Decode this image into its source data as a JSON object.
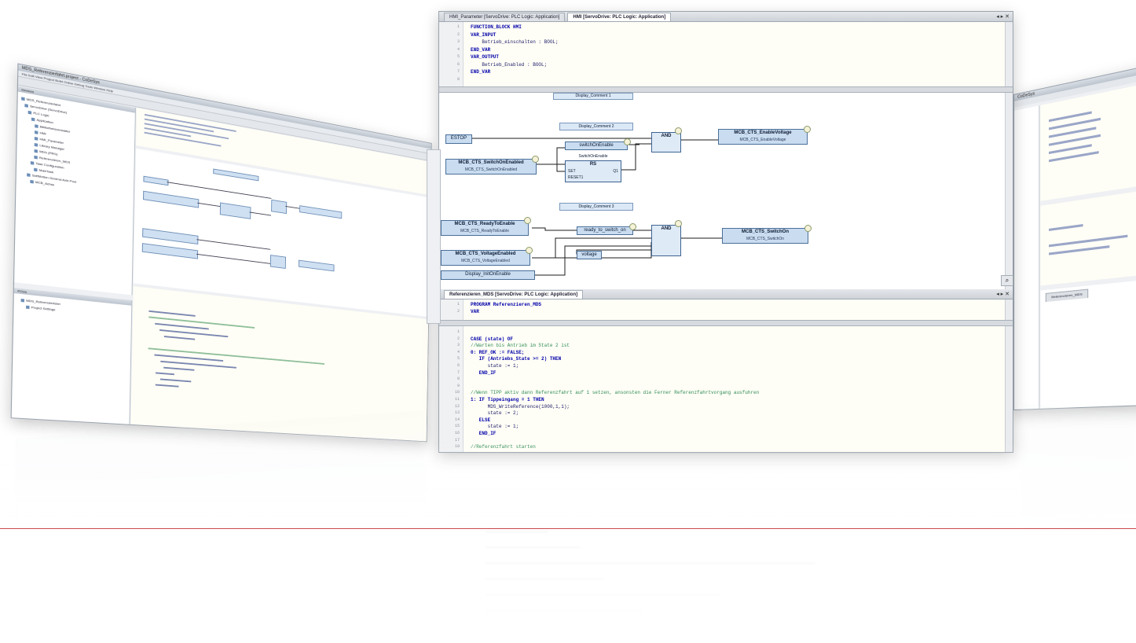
{
  "center_window": {
    "tabs": [
      {
        "label": "HMI_Parameter [ServoDrive: PLC Logic: Application]"
      },
      {
        "label": "HMI [ServoDrive: PLC Logic: Application]"
      }
    ],
    "window_controls": "◂ ▸ ✕",
    "declaration": [
      {
        "ln": "1",
        "text": "FUNCTION_BLOCK HMI",
        "style": "kw"
      },
      {
        "ln": "2",
        "text": "VAR_INPUT",
        "style": "kw"
      },
      {
        "ln": "3",
        "text": "    Betrieb_einschalten : BOOL;",
        "style": ""
      },
      {
        "ln": "4",
        "text": "END_VAR",
        "style": "kw"
      },
      {
        "ln": "5",
        "text": "VAR_OUTPUT",
        "style": "kw"
      },
      {
        "ln": "6",
        "text": "    Betrieb_Enabled : BOOL;",
        "style": ""
      },
      {
        "ln": "7",
        "text": "END_VAR",
        "style": "kw"
      },
      {
        "ln": "8",
        "text": "",
        "style": ""
      }
    ],
    "fbd": {
      "labels": {
        "comment1": "Display_Comment 1",
        "comment2": "Display_Comment 2",
        "comment3": "Display_Comment 3",
        "estop": "ESTOP",
        "mc_switch_title": "MCB_CTS_SwitchOnEnabled",
        "mc_switch_sub": "MCB_CTS_SwitchOnEnabled",
        "switchable": "switchOnEnable",
        "rs_label": "SwitchOnEnable",
        "rs_title": "RS",
        "rs_set": "SET",
        "rs_reset": "RESET1",
        "rs_q": "Q1",
        "and1": "AND",
        "out1_title": "MCB_CTS_EnableVoltage",
        "out1_sub": "MCB_CTS_EnableVoltage",
        "ready_title": "MCB_CTS_ReadyToEnable",
        "ready_sub": "MCB_CTS_ReadyToEnable",
        "ready_var": "ready_to_switch_on",
        "volt_title": "MCB_CTS_VoltageEnabled",
        "volt_sub": "MCB_CTS_VoltageEnabled",
        "voltage": "voltage",
        "and2": "AND",
        "out2_title": "MCB_CTS_SwitchOn",
        "out2_sub": "MCB_CTS_SwitchOn",
        "display_var": "Display_InitOnEnable"
      }
    },
    "bottom_tabs": [
      {
        "label": "Referenzieren_MDS [ServoDrive: PLC Logic: Application]"
      }
    ],
    "bottom_declaration": [
      {
        "ln": "1",
        "text": "PROGRAM Referenzieren_MDS",
        "style": "kw"
      },
      {
        "ln": "2",
        "text": "VAR",
        "style": "kw"
      }
    ],
    "body_code": [
      {
        "ln": "1",
        "text": "",
        "style": ""
      },
      {
        "ln": "2",
        "text": "CASE (state) OF",
        "style": "kw"
      },
      {
        "ln": "3",
        "text": "//Warten bis Antrieb im State 2 ist",
        "style": "cm"
      },
      {
        "ln": "4",
        "text": "0: REF_OK := FALSE;",
        "style": "kw"
      },
      {
        "ln": "5",
        "text": "   IF (Antriebs_State >= 2) THEN",
        "style": "kw"
      },
      {
        "ln": "6",
        "text": "      state := 1;",
        "style": ""
      },
      {
        "ln": "7",
        "text": "   END_IF",
        "style": "kw"
      },
      {
        "ln": "8",
        "text": "",
        "style": ""
      },
      {
        "ln": "9",
        "text": "",
        "style": ""
      },
      {
        "ln": "10",
        "text": "//Wenn TIPP aktiv dann Referenzfahrt auf 1 setzen, ansonsten die Ferner Referenzfahrtvorgang ausfuhren",
        "style": "cm"
      },
      {
        "ln": "11",
        "text": "1: IF Tippeingang = 1 THEN",
        "style": "kw"
      },
      {
        "ln": "12",
        "text": "      MDS_WriteReference(1000,1,1);",
        "style": ""
      },
      {
        "ln": "13",
        "text": "      state := 2;",
        "style": ""
      },
      {
        "ln": "14",
        "text": "   ELSE",
        "style": "kw"
      },
      {
        "ln": "15",
        "text": "      state := 1;",
        "style": ""
      },
      {
        "ln": "16",
        "text": "   END_IF",
        "style": "kw"
      },
      {
        "ln": "17",
        "text": "",
        "style": ""
      },
      {
        "ln": "18",
        "text": "//Referenzfahrt starten",
        "style": "cm"
      }
    ]
  },
  "left_window": {
    "title": "MDS_Referenzierfahrt.project - CoDeSys",
    "menu": "File  Edit  View  Project  Build  Online  Debug  Tools  Window  Help",
    "devices_title": "Devices",
    "tree_items": [
      "MDS_Referenzierfahrt",
      "ServoDrive (ServoDrive)",
      "PLC Logic",
      "Application",
      "Bibliotheksverwalter",
      "HMI",
      "HMI_Parameter",
      "Library Manager",
      "MDS (PRG)",
      "Referenzieren_MDS",
      "Task Configuration",
      "MainTask",
      "SoftMotion General Axis Pool",
      "MCB_Achse"
    ],
    "pou_title": "POUs",
    "pou_items": [
      "MDS_Referenzierfahrt",
      "Project Settings"
    ]
  },
  "right_window": {
    "title": "CoDeSys",
    "tab": "Referenzieren_MDS"
  }
}
